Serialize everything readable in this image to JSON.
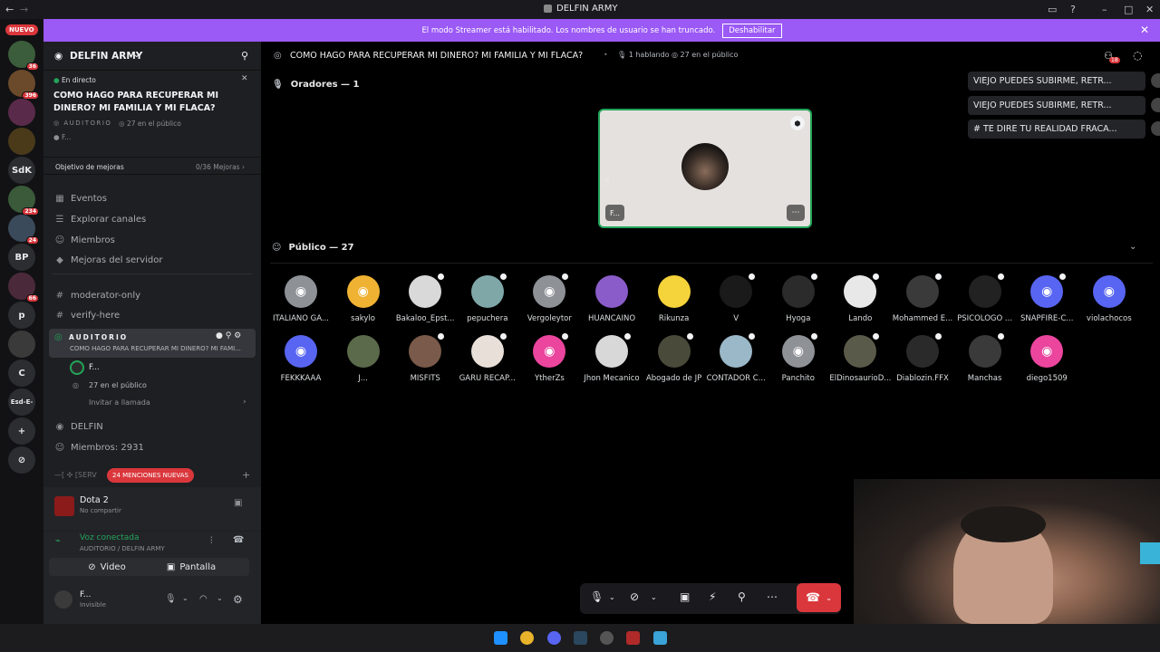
{
  "window": {
    "title": "DELFIN ARMY"
  },
  "rail": {
    "new_badge": "NUEVO",
    "items": [
      {
        "label": "",
        "badge": "36",
        "color": "#3b5d3b"
      },
      {
        "label": "",
        "badge": "396",
        "color": "#6a4a2a"
      },
      {
        "label": "",
        "badge": "",
        "color": "#5a2a4a"
      },
      {
        "label": "",
        "badge": "",
        "color": "#4a3a1a"
      },
      {
        "label": "SdK",
        "badge": "",
        "color": "#2b2d31"
      },
      {
        "label": "",
        "badge": "234",
        "color": "#3a5a3a"
      },
      {
        "label": "",
        "badge": "24",
        "color": "#3a4a5a"
      },
      {
        "label": "BP",
        "badge": "",
        "color": "#2b2d31"
      },
      {
        "label": "",
        "badge": "66",
        "color": "#4a2a3a"
      },
      {
        "label": "p",
        "badge": "",
        "color": "#2b2d31"
      },
      {
        "label": "",
        "badge": "",
        "color": "#3a3a3a"
      },
      {
        "label": "C",
        "badge": "",
        "color": "#2b2d31"
      },
      {
        "label": "Esd-E-",
        "badge": "",
        "color": "#2b2d31"
      },
      {
        "label": "+",
        "badge": "",
        "color": "#2b2d31"
      },
      {
        "label": "⊘",
        "badge": "",
        "color": "#2b2d31"
      }
    ]
  },
  "banner": {
    "text": "El modo Streamer está habilitado. Los nombres de usuario se han truncado.",
    "button": "Deshabilitar"
  },
  "sidebar": {
    "server_name": "DELFIN ARMY",
    "live": {
      "status": "En directo",
      "title": "COMO HAGO PARA RECUPERAR MI DINERO? MI FAMILIA Y MI FLACA?",
      "channel": "AUDITORIO",
      "audience": "27 en el público",
      "host": "F..."
    },
    "goal": {
      "label": "Objetivo de mejoras",
      "progress": "0/36 Mejoras"
    },
    "menu": [
      "Eventos",
      "Explorar canales",
      "Miembros",
      "Mejoras del servidor"
    ],
    "channels": [
      "moderator-only",
      "verify-here"
    ],
    "stage": {
      "name": "AUDITORIO",
      "topic": "COMO HAGO PARA RECUPERAR MI DINERO? MI FAMI...",
      "speaker": "F...",
      "audience": "27 en el público",
      "invite": "Invitar a llamada"
    },
    "category": "DELFIN",
    "members": "Miembros: 2931",
    "mentions": "24 MENCIONES NUEVAS",
    "partial_channel": "[SERV"
  },
  "userpanel": {
    "activity_title": "Dota 2",
    "activity_sub": "No compartir",
    "voice_status": "Voz conectada",
    "voice_sub": "AUDITORIO / DELFIN ARMY",
    "video_btn": "Video",
    "screen_btn": "Pantalla",
    "username": "F...",
    "user_status": "Invisible"
  },
  "stage": {
    "title": "COMO HAGO PARA RECUPERAR MI DINERO? MI FAMILIA Y MI FLACA?",
    "speaking": "1 hablando",
    "audience": "27 en el público",
    "notif_count": "18",
    "speakers_header": "Oradores — 1",
    "speaker_name": "F...",
    "public_header": "Público — 27"
  },
  "side_messages": [
    "VIEJO PUEDES SUBIRME, RETR...",
    "VIEJO PUEDES SUBIRME, RETR...",
    "# TE DIRE TU REALIDAD FRACA..."
  ],
  "audience": [
    {
      "name": "ITALIANO GA...",
      "color": "#8e9297",
      "mod": false,
      "discord": true
    },
    {
      "name": "sakylo",
      "color": "#f0b232",
      "mod": false,
      "discord": true
    },
    {
      "name": "Bakaloo_Epst...",
      "color": "#d9d9d9",
      "mod": true,
      "discord": false
    },
    {
      "name": "pepuchera",
      "color": "#7fa7a8",
      "mod": true,
      "discord": false
    },
    {
      "name": "Vergoleytor",
      "color": "#8e9297",
      "mod": true,
      "discord": true
    },
    {
      "name": "HUANCAINO",
      "color": "#8a5cc9",
      "mod": false,
      "discord": false
    },
    {
      "name": "Rikunza",
      "color": "#f5d33a",
      "mod": false,
      "discord": false
    },
    {
      "name": "V",
      "color": "#1a1a1a",
      "mod": true,
      "discord": false
    },
    {
      "name": "Hyoga",
      "color": "#2b2b2b",
      "mod": true,
      "discord": false
    },
    {
      "name": "Lando",
      "color": "#e8e8e8",
      "mod": true,
      "discord": false
    },
    {
      "name": "Mohammed E...",
      "color": "#3a3a3a",
      "mod": true,
      "discord": false
    },
    {
      "name": "PSICOLOGO ...",
      "color": "#222222",
      "mod": true,
      "discord": false
    },
    {
      "name": "SNAPFIRE-C...",
      "color": "#5865f2",
      "mod": true,
      "discord": true
    },
    {
      "name": "violachocos",
      "color": "#5865f2",
      "mod": false,
      "discord": true
    },
    {
      "name": "FEKKKAAA",
      "color": "#5865f2",
      "mod": false,
      "discord": true
    },
    {
      "name": "J...",
      "color": "#5a6a4a",
      "mod": false,
      "discord": false
    },
    {
      "name": "MISFITS",
      "color": "#7a5a4a",
      "mod": true,
      "discord": false
    },
    {
      "name": "GARU RECAP...",
      "color": "#e8e0d8",
      "mod": true,
      "discord": false
    },
    {
      "name": "YtherZs",
      "color": "#eb459e",
      "mod": true,
      "discord": true
    },
    {
      "name": "Jhon Mecanico",
      "color": "#d8d8d8",
      "mod": true,
      "discord": false
    },
    {
      "name": "Abogado de JP",
      "color": "#4a4a3a",
      "mod": true,
      "discord": false
    },
    {
      "name": "CONTADOR C...",
      "color": "#9ab8c8",
      "mod": true,
      "discord": false
    },
    {
      "name": "Panchito",
      "color": "#8e9297",
      "mod": true,
      "discord": true
    },
    {
      "name": "ElDinosaurioD...",
      "color": "#5a5a4a",
      "mod": true,
      "discord": false
    },
    {
      "name": "Diablozin.FFX",
      "color": "#2a2a2a",
      "mod": true,
      "discord": false
    },
    {
      "name": "Manchas",
      "color": "#3a3a3a",
      "mod": true,
      "discord": false
    },
    {
      "name": "diego1509",
      "color": "#eb459e",
      "mod": false,
      "discord": true
    }
  ]
}
